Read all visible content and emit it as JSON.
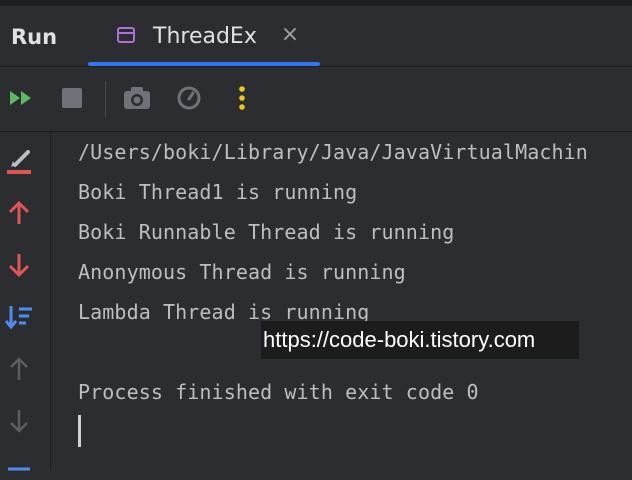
{
  "header": {
    "title": "Run"
  },
  "tab": {
    "label": "ThreadEx",
    "close_glyph": "×",
    "icon": "class-icon"
  },
  "toolbar": {
    "rerun_icon": "rerun-icon",
    "stop_icon": "stop-icon",
    "camera_icon": "camera-icon",
    "settings_icon": "gauge-icon",
    "more_icon": "more-vertical-icon"
  },
  "sidebar": {
    "icons": [
      "soft-wrap-icon",
      "arrow-up-icon",
      "arrow-down-icon",
      "sort-icon",
      "arrow-up-icon",
      "arrow-down-icon",
      "list-icon"
    ]
  },
  "console": {
    "lines": [
      "/Users/boki/Library/Java/JavaVirtualMachin",
      "Boki Thread1 is running",
      "Boki Runnable Thread is running",
      "Anonymous Thread is running",
      "Lambda Thread is running",
      "",
      "Process finished with exit code 0"
    ]
  },
  "watermark": {
    "text": "https://code-boki.tistory.com"
  },
  "colors": {
    "background": "#2b2d30",
    "text": "#bcbec4",
    "accent": "#3574f0",
    "run_green": "#5fb865",
    "red": "#e05555",
    "blue": "#4d8ef0",
    "yellow": "#f0c419",
    "tab_icon": "#b06fd6"
  }
}
